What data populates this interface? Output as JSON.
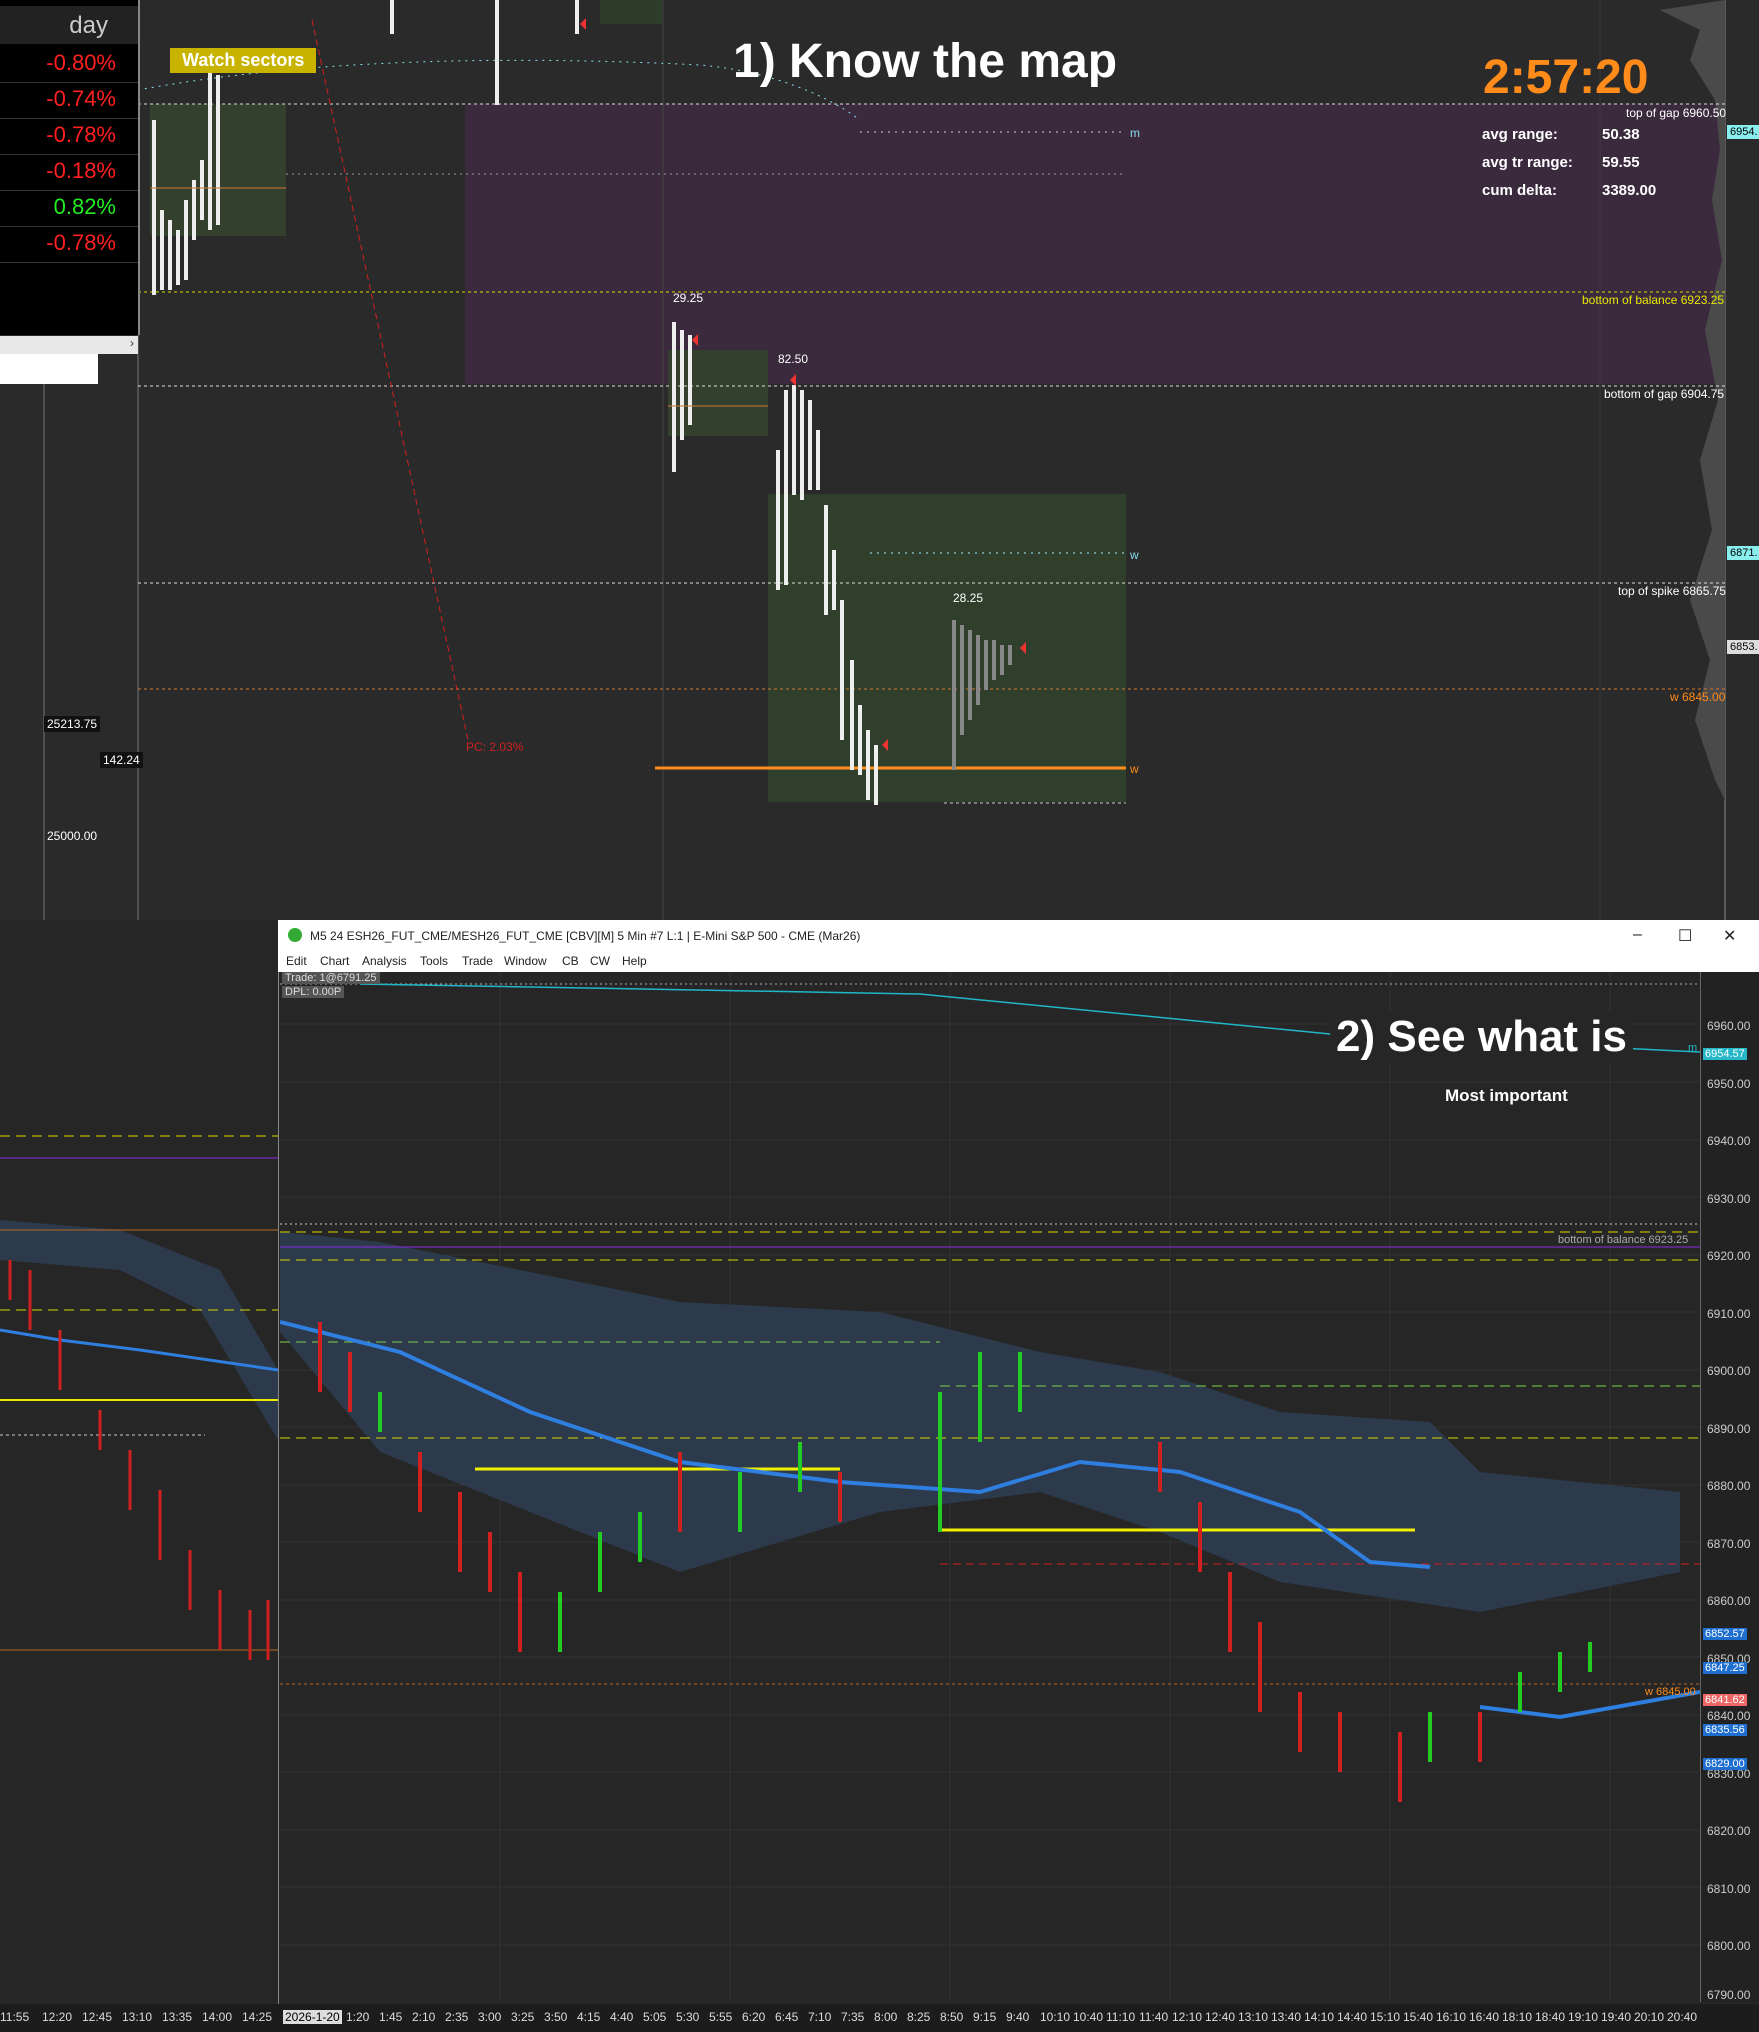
{
  "top": {
    "day_label": "day",
    "sectors": [
      "-0.80%",
      "-0.74%",
      "-0.78%",
      "-0.18%",
      "0.82%",
      "-0.78%"
    ],
    "sector_signs": [
      "neg",
      "neg",
      "neg",
      "neg",
      "pos",
      "neg"
    ],
    "watch_sectors": "Watch sectors",
    "title_1": "1)  Know the map",
    "clock": "2:57:20",
    "stats": {
      "avg_range_label": "avg range:",
      "avg_range": "50.38",
      "avg_tr_range_label": "avg tr range:",
      "avg_tr_range": "59.55",
      "cum_delta_label": "cum delta:",
      "cum_delta": "3389.00"
    },
    "level_labels": {
      "top_of_gap": "top of gap  6960.50",
      "bottom_of_balance": "bottom of balance  6923.25",
      "bottom_of_gap": "bottom of gap  6904.75",
      "top_of_spike": "top of spike  6865.75",
      "w_6845": "w  6845.00",
      "m": "m",
      "w": "w",
      "w2": "w"
    },
    "profile_labels": [
      "29.25",
      "82.50",
      "28.25"
    ],
    "pc_label": "PC: 2.03%",
    "left_prices": [
      "25213.75",
      "142.24",
      "25000.00"
    ],
    "right_tags": [
      "6954.",
      "6871.",
      "6853."
    ],
    "right_tag_colors": [
      "#8ee",
      "#8ee",
      "#ddd"
    ]
  },
  "window": {
    "title": "M5 24 ESH26_FUT_CME/MESH26_FUT_CME [CBV][M]  5 Min  #7 L:1 | E-Mini S&P 500 - CME (Mar26)",
    "menu": [
      "Edit",
      "Chart",
      "Analysis",
      "Tools",
      "Trade",
      "Window",
      "CB",
      "CW",
      "Help"
    ],
    "trade_info": "Trade: 1@6791.25",
    "dpl_info": "DPL: 0.00P",
    "title_2": "2)  See what is",
    "subtitle_2": "Most important",
    "bottom_of_balance": "bottom of balance  6923.25",
    "w_label": "w  6845.00",
    "m_label": "m",
    "price_ticks": [
      "6960.00",
      "6950.00",
      "6940.00",
      "6930.00",
      "6920.00",
      "6910.00",
      "6900.00",
      "6890.00",
      "6880.00",
      "6870.00",
      "6860.00",
      "6850.00",
      "6840.00",
      "6830.00",
      "6820.00",
      "6810.00",
      "6800.00",
      "6790.00"
    ],
    "price_tags": [
      "6954.57",
      "6852.57",
      "6847.25",
      "6841.62",
      "6835.56",
      "6829.00"
    ],
    "price_tag_colors": [
      "#26b8c8",
      "#1e6fd0",
      "#1e6fd0",
      "#e66",
      "#1e6fd0",
      "#1e6fd0"
    ],
    "left_time_ticks": [
      "11:55",
      "12:20",
      "12:45",
      "13:10",
      "13:35",
      "14:00",
      "14:25"
    ],
    "time_ticks": [
      "2026-1-20",
      "1:20",
      "1:45",
      "2:10",
      "2:35",
      "3:00",
      "3:25",
      "3:50",
      "4:15",
      "4:40",
      "5:05",
      "5:30",
      "5:55",
      "6:20",
      "6:45",
      "7:10",
      "7:35",
      "8:00",
      "8:25",
      "8:50",
      "9:15",
      "9:40",
      "10:10",
      "10:40",
      "11:10",
      "11:40",
      "12:10",
      "12:40",
      "13:10",
      "13:40",
      "14:10",
      "14:40",
      "15:10",
      "15:40",
      "16:10",
      "16:40",
      "18:10",
      "18:40",
      "19:10",
      "19:40",
      "20:10",
      "20:40"
    ]
  }
}
